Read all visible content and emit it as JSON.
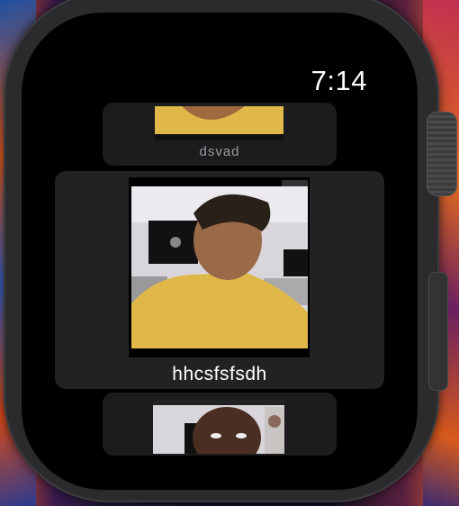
{
  "status": {
    "time": "7:14"
  },
  "participants": [
    {
      "name": "dsvad",
      "video": "participant-video-dsvad"
    },
    {
      "name": "hhcsfsfsdh",
      "video": "participant-video-hhcsfsfsdh"
    },
    {
      "name": "",
      "video": "participant-video-third"
    }
  ],
  "colors": {
    "card_background": "#1c1c1e",
    "focused_card_background": "#222224",
    "shirt": "#e0b84a",
    "secondary_label": "#9a9a9e"
  },
  "icons": [
    "digital-crown-icon",
    "side-button-icon"
  ]
}
